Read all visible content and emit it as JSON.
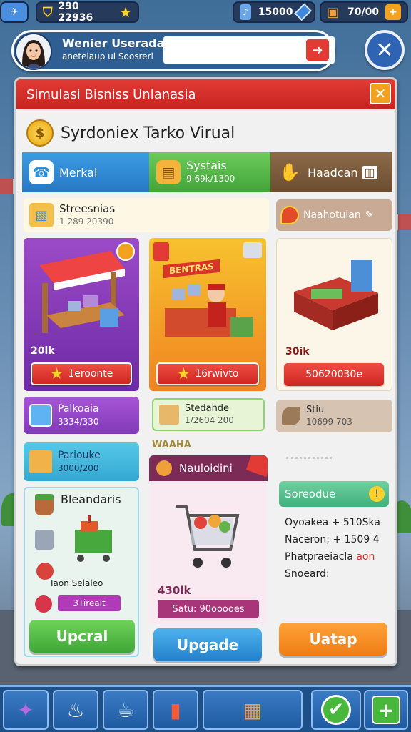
{
  "top_bar": {
    "coins_value": "290 22936",
    "gems_value": "15000",
    "energy_value": "70/00"
  },
  "profile": {
    "name": "Wenier Useradas",
    "subtitle": "anetelaup ul Soosrerl"
  },
  "panel": {
    "title": "Simulasi Bisniss Unlanasia",
    "shop_name": "Syrdoniex Tarko Virual",
    "coin_glyph": "$"
  },
  "tabs": [
    {
      "label": "Merkal"
    },
    {
      "label": "Systais",
      "sub": "9.69k/1300"
    },
    {
      "label": "Haadcan"
    }
  ],
  "stat_row": {
    "title": "Streesnias",
    "sub": "1.289 20390"
  },
  "notification": {
    "label": "Naahotuian"
  },
  "shops": [
    {
      "price": "20lk",
      "button": "1eroonte"
    },
    {
      "sign": "BENTRAS",
      "button": "16rwivto"
    },
    {
      "price": "30ik",
      "button": "50620030e"
    }
  ],
  "rows2": {
    "packages": {
      "title": "Palkoaia",
      "sub": "3334/330"
    },
    "stock": {
      "title": "Stedahde",
      "sub": "1/2604 200"
    },
    "item": {
      "title": "Stiu",
      "sub": "10699 703"
    },
    "partner": {
      "title": "Pariouke",
      "sub": "3000/200"
    }
  },
  "bottom_left": {
    "title": "Bleandaris",
    "item_label": "Iaon Selaleo",
    "pill": "3Tireait",
    "upgrade": "Upcral"
  },
  "center": {
    "header_small": "WAAHA",
    "title": "Nauloidini",
    "price": "430lk",
    "sale": "Satu: 90ooooes",
    "upgrade": "Upgade"
  },
  "right_col": {
    "title": "Soreodue",
    "lines": [
      "Oyoakea + 510Ska",
      "Naceron; + 1509 4",
      "Phatpraeiacla",
      "Snoeard:"
    ],
    "highlight": "aon",
    "button": "Uatap"
  },
  "colors": {
    "panel_red": "#d32b26",
    "tab_blue": "#2f8fd8",
    "tab_green": "#4cb84c",
    "tab_brown": "#7b5a3a",
    "upgrade_green": "#48b83c",
    "upgrade_blue": "#2c8fdc",
    "upgrade_orange": "#f28b1d"
  }
}
